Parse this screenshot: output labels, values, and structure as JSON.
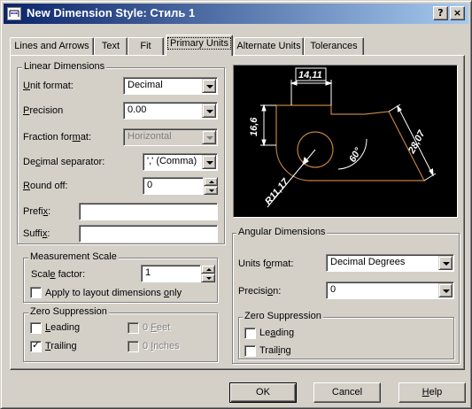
{
  "window": {
    "title": "New Dimension Style: Стиль 1",
    "help_button": "?",
    "close_button": "×"
  },
  "tabs": [
    {
      "label": "Lines and Arrows",
      "active": false
    },
    {
      "label": "Text",
      "active": false
    },
    {
      "label": "Fit",
      "active": false
    },
    {
      "label": "Primary Units",
      "active": true
    },
    {
      "label": "Alternate Units",
      "active": false
    },
    {
      "label": "Tolerances",
      "active": false
    }
  ],
  "linear": {
    "group_label": "Linear Dimensions",
    "unit_format": {
      "label_u": "U",
      "label_rest": "nit format:",
      "value": "Decimal"
    },
    "precision": {
      "label_u": "P",
      "label_rest": "recision",
      "value": "0.00"
    },
    "fraction_format": {
      "label_pre": "Fraction for",
      "label_u": "m",
      "label_rest": "at:",
      "value": "Horizontal"
    },
    "decimal_separator": {
      "label_pre": "De",
      "label_u": "c",
      "label_rest": "imal separator:",
      "value": "',' (Comma)"
    },
    "round_off": {
      "label_u": "R",
      "label_rest": "ound off:",
      "value": "0"
    },
    "prefix": {
      "label_pre": "Prefi",
      "label_u": "x",
      "label_rest": ":",
      "value": ""
    },
    "suffix": {
      "label_pre": "Suffi",
      "label_u": "x",
      "label_rest": ":",
      "value": ""
    }
  },
  "measurement_scale": {
    "group_label": "Measurement Scale",
    "scale_factor": {
      "label_pre": "Scal",
      "label_u": "e",
      "label_rest": " factor:",
      "value": "1"
    },
    "apply_layout": {
      "label_pre": "Apply to layout dimensions ",
      "label_u": "o",
      "label_rest": "nly",
      "checked": false
    }
  },
  "zero_suppression_linear": {
    "group_label": "Zero Suppression",
    "leading": {
      "label_u": "L",
      "label_rest": "eading",
      "checked": false
    },
    "trailing": {
      "label_u": "T",
      "label_rest": "railing",
      "checked": true
    },
    "feet": {
      "label_pre": "0 ",
      "label_u": "F",
      "label_rest": "eet",
      "checked": false,
      "disabled": true
    },
    "inches": {
      "label_pre": "0 ",
      "label_u": "I",
      "label_rest": "nches",
      "checked": false,
      "disabled": true
    }
  },
  "preview": {
    "labels": {
      "top": "14,11",
      "left": "16,6",
      "right": "28,07",
      "angle": "60°",
      "radius": "R11,17"
    },
    "colors": {
      "background": "#000000",
      "geometry": "#c08040",
      "dimension": "#ffffff",
      "text": "#ffffff"
    }
  },
  "angular": {
    "group_label": "Angular Dimensions",
    "units_format": {
      "label_pre": "Units f",
      "label_u": "o",
      "label_rest": "rmat:",
      "value": "Decimal Degrees"
    },
    "precision": {
      "label_pre": "Precisi",
      "label_u": "o",
      "label_rest": "n:",
      "value": "0"
    }
  },
  "zero_suppression_angular": {
    "group_label": "Zero Suppression",
    "leading": {
      "label_pre": "Le",
      "label_u": "a",
      "label_rest": "ding",
      "checked": false
    },
    "trailing": {
      "label_pre": "Trail",
      "label_u": "i",
      "label_rest": "ng",
      "checked": false
    }
  },
  "buttons": {
    "ok": "OK",
    "cancel": "Cancel",
    "help_u": "H",
    "help_rest": "elp"
  }
}
